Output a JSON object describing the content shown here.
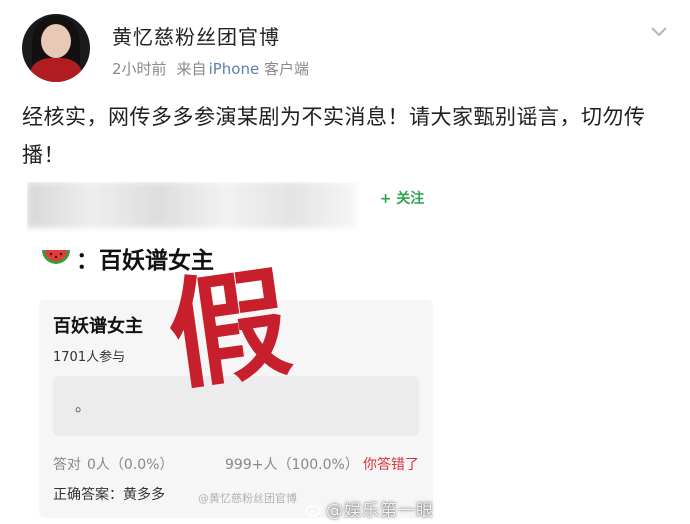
{
  "post": {
    "username": "黄忆慈粉丝团官博",
    "time": "2小时前",
    "source_prefix": "来自",
    "device": "iPhone",
    "device_suffix": " 客户端",
    "text": "经核实，网传多多参演某剧为不实消息！请大家甄别谣言，切勿传播！",
    "icons": {
      "more": "chevron-down-icon",
      "avatar": "user-avatar"
    }
  },
  "screenshot_card": {
    "follow_button": "+ 关注",
    "topic_icon": "watermelon-icon",
    "topic_title": "：百妖谱女主",
    "quiz": {
      "title": "百妖谱女主",
      "participants": "1701人参与",
      "option_text": "。",
      "correct_label": "答对",
      "correct_count": "0人（0.0%）",
      "wrong_count": "999+人（100.0%）",
      "wrong_verdict": "你答错了",
      "answer": "正确答案：黄多多"
    },
    "stamp_text": "假"
  },
  "watermarks": {
    "small": "@黄忆慈粉丝团官博",
    "large": "@娱乐第一眼"
  },
  "colors": {
    "accent_link": "#5b7fb0",
    "follow_green": "#2ea44f",
    "stamp_red": "#c7202c",
    "wrong_red": "#d8313c"
  }
}
